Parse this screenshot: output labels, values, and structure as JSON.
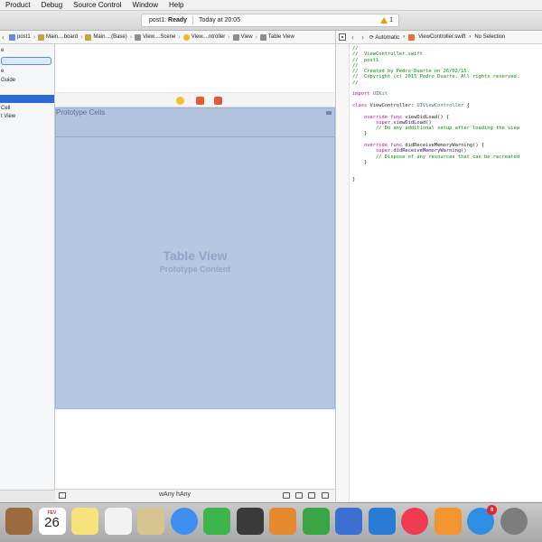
{
  "menubar": {
    "items": [
      "Product",
      "Debug",
      "Source Control",
      "Window",
      "Help"
    ]
  },
  "toolbar": {
    "scheme": "post1:",
    "state": "Ready",
    "timestamp": "Today at 20:05",
    "warning_count": "1"
  },
  "jumpbar": {
    "crumbs": [
      "post1",
      "Main....board",
      "Main....(Base)",
      "View....Scene",
      "View....ntroller",
      "View",
      "Table View"
    ]
  },
  "assistant_jumpbar": {
    "mode": "Automatic",
    "file": "ViewController.swift",
    "selection": "No Selection"
  },
  "outline": {
    "rows": [
      "e",
      "",
      "e",
      "Guide",
      "",
      "",
      "Cell",
      "t View"
    ]
  },
  "canvas": {
    "prototype_cells": "Prototype Cells",
    "table_view_title": "Table View",
    "table_view_subtitle": "Prototype Content",
    "size_class": "wAny hAny"
  },
  "code": {
    "lines": [
      "//",
      "//  ViewController.swift",
      "//  post1",
      "//",
      "//  Created by Pedro Duarte on 26/02/15.",
      "//  Copyright (c) 2015 Pedro Duarte. All rights reserved.",
      "//",
      "",
      "import UIKit",
      "",
      "class ViewController: UIViewController {",
      "",
      "    override func viewDidLoad() {",
      "        super.viewDidLoad()",
      "        // Do any additional setup after loading the view",
      "    }",
      "",
      "    override func didReceiveMemoryWarning() {",
      "        super.didReceiveMemoryWarning()",
      "        // Dispose of any resources that can be recreated",
      "    }",
      "",
      "",
      "}"
    ]
  },
  "dock": {
    "calendar_month": "FEV",
    "calendar_day": "26",
    "appstore_badge": "6",
    "items": [
      {
        "name": "contacts",
        "color": "#9b6a3e"
      },
      {
        "name": "calendar",
        "color": "#ffffff"
      },
      {
        "name": "notes",
        "color": "#f7e27b"
      },
      {
        "name": "reminders",
        "color": "#f2f2f2"
      },
      {
        "name": "maps",
        "color": "#d8c48f"
      },
      {
        "name": "messages",
        "color": "#3f8ff0"
      },
      {
        "name": "facetime",
        "color": "#3cb54a"
      },
      {
        "name": "photo-booth",
        "color": "#3a3a3a"
      },
      {
        "name": "pages",
        "color": "#e68a2f"
      },
      {
        "name": "numbers",
        "color": "#3aa544"
      },
      {
        "name": "keynote",
        "color": "#3b6fd1"
      },
      {
        "name": "xcode-instruments",
        "color": "#2a7bd4"
      },
      {
        "name": "itunes",
        "color": "#ef3b52"
      },
      {
        "name": "ibooks",
        "color": "#f2952c"
      },
      {
        "name": "app-store",
        "color": "#2f8de4"
      },
      {
        "name": "system-preferences",
        "color": "#7d7d7d"
      }
    ]
  }
}
